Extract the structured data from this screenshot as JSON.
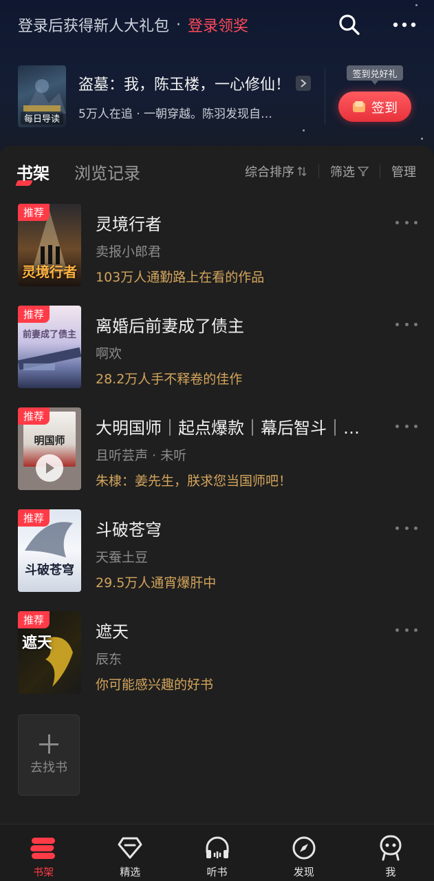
{
  "header": {
    "login_text": "登录后获得新人大礼包",
    "dot": "·",
    "login_link": "登录领奖"
  },
  "recommend": {
    "cover_label": "每日导读",
    "title": "盗墓：我，陈玉楼，一心修仙！",
    "desc": "5万人在追 · 一朝穿越。陈羽发现自…"
  },
  "checkin": {
    "tooltip": "签到兑好礼",
    "button": "签到"
  },
  "tabs": {
    "bookshelf": "书架",
    "history": "浏览记录"
  },
  "tools": {
    "sort": "综合排序",
    "filter": "筛选",
    "manage": "管理"
  },
  "books": [
    {
      "badge": "推荐",
      "cover_text": "灵境行者",
      "title": "灵境行者",
      "author": "卖报小郎君",
      "note": "103万人通勤路上在看的作品"
    },
    {
      "badge": "推荐",
      "cover_text": "前妻成了债主",
      "title": "离婚后前妻成了债主",
      "author": "啊欢",
      "note": "28.2万人手不释卷的佳作"
    },
    {
      "badge": "推荐",
      "cover_text": "明国师",
      "title": "大明国师｜起点爆款｜幕后智斗｜…",
      "author": "且听芸声 · 未听",
      "note": "朱棣：姜先生，朕求您当国师吧！"
    },
    {
      "badge": "推荐",
      "cover_text": "斗破苍穹",
      "title": "斗破苍穹",
      "author": "天蚕土豆",
      "note": "29.5万人通宵爆肝中"
    },
    {
      "badge": "推荐",
      "cover_text": "遮天",
      "title": "遮天",
      "author": "辰东",
      "note": "你可能感兴趣的好书"
    }
  ],
  "find_book": "去找书",
  "nav": [
    {
      "label": "书架",
      "icon": "bookshelf-icon"
    },
    {
      "label": "精选",
      "icon": "diamond-icon"
    },
    {
      "label": "听书",
      "icon": "headphones-icon"
    },
    {
      "label": "发现",
      "icon": "compass-icon"
    },
    {
      "label": "我",
      "icon": "profile-icon"
    }
  ],
  "colors": {
    "accent": "#ff3b47",
    "note": "#d4a55c",
    "background": "#1f1f1f"
  }
}
